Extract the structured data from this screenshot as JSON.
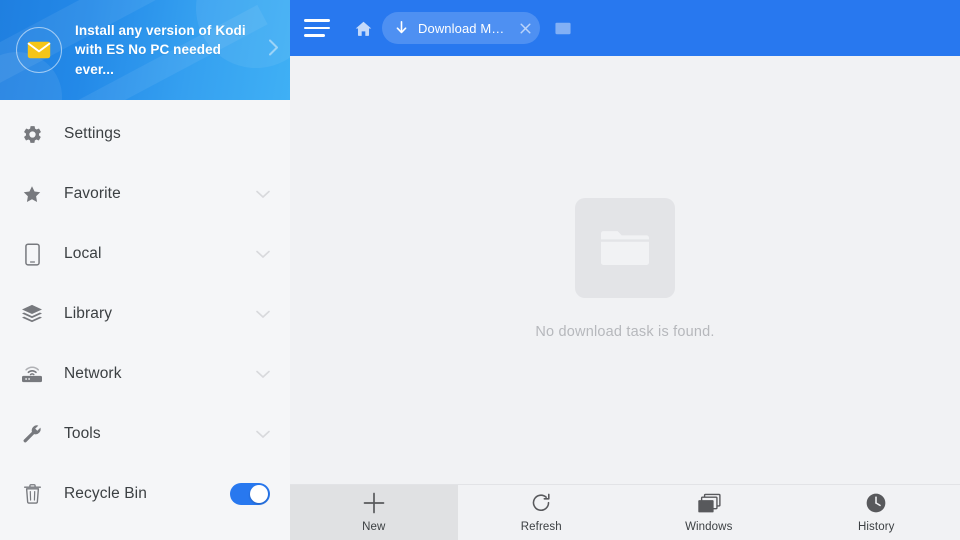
{
  "sidebar": {
    "promo": {
      "icon": "envelope-icon",
      "line1": "Install any version of Kodi",
      "line2": "with ES No PC needed ever...",
      "arrow": "chevron-right-icon"
    },
    "items": [
      {
        "label": "Settings",
        "icon": "gear-icon",
        "expandable": false,
        "toggle": false
      },
      {
        "label": "Favorite",
        "icon": "star-icon",
        "expandable": true,
        "toggle": false
      },
      {
        "label": "Local",
        "icon": "phone-icon",
        "expandable": true,
        "toggle": false
      },
      {
        "label": "Library",
        "icon": "layers-icon",
        "expandable": true,
        "toggle": false
      },
      {
        "label": "Network",
        "icon": "router-icon",
        "expandable": true,
        "toggle": false
      },
      {
        "label": "Tools",
        "icon": "wrench-icon",
        "expandable": true,
        "toggle": false
      },
      {
        "label": "Recycle Bin",
        "icon": "trash-icon",
        "expandable": false,
        "toggle": true,
        "toggle_on": true
      }
    ]
  },
  "topbar": {
    "menu_icon": "hamburger-icon",
    "home_icon": "home-icon",
    "tab": {
      "icon": "download-arrow-icon",
      "title": "Download Ma...",
      "close_icon": "close-icon"
    },
    "new_tab_icon": "new-window-icon"
  },
  "content": {
    "empty_icon": "folder-icon",
    "empty_message": "No download task is found."
  },
  "bottombar": {
    "items": [
      {
        "label": "New",
        "icon": "plus-icon",
        "active": true
      },
      {
        "label": "Refresh",
        "icon": "refresh-icon",
        "active": false
      },
      {
        "label": "Windows",
        "icon": "windows-icon",
        "active": false
      },
      {
        "label": "History",
        "icon": "clock-icon",
        "active": false
      }
    ]
  },
  "colors": {
    "accent_blue": "#2878ef",
    "banner_blue_start": "#1f7fe0",
    "banner_blue_end": "#3fb0f5",
    "sidebar_bg": "#f5f6f8",
    "content_bg": "#f1f2f4",
    "empty_card": "#e3e4e7",
    "muted_text": "#b6b8bc",
    "envelope_yellow": "#f5c518"
  }
}
